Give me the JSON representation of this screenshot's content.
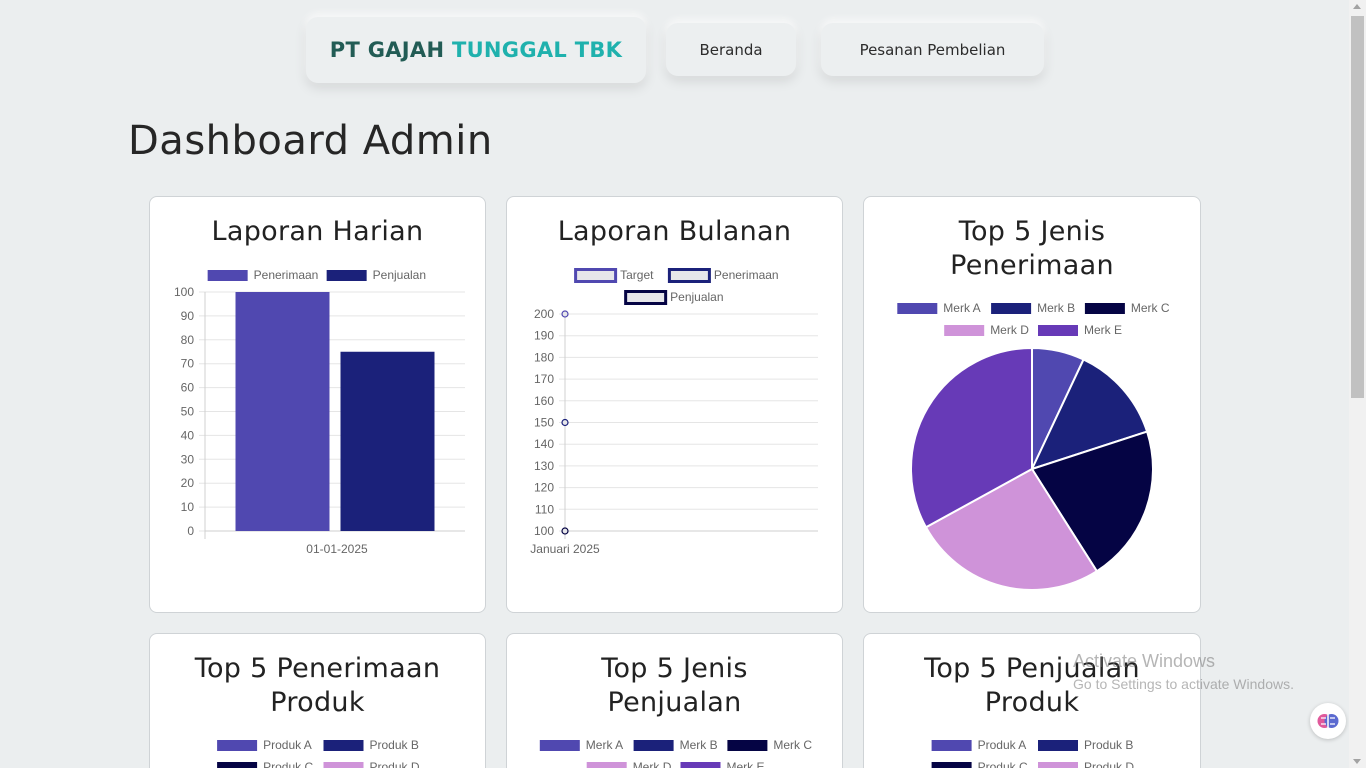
{
  "header": {
    "brand_part1": "PT GAJAH",
    "brand_part2": "TUNGGAL TBK",
    "nav_home": "Beranda",
    "nav_orders": "Pesanan Pembelian"
  },
  "page_title": "Dashboard Admin",
  "cards": [
    {
      "title": "Laporan Harian"
    },
    {
      "title": "Laporan Bulanan"
    },
    {
      "title_line1": "Top 5 Jenis",
      "title_line2": "Penerimaan"
    },
    {
      "title_line1": "Top 5 Penerimaan",
      "title_line2": "Produk"
    },
    {
      "title_line1": "Top 5 Jenis",
      "title_line2": "Penjualan"
    },
    {
      "title_line1": "Top 5 Penjualan",
      "title_line2": "Produk"
    }
  ],
  "watermark": {
    "line1": "Activate Windows",
    "line2": "Go to Settings to activate Windows."
  },
  "icons": {
    "floating_button": "brain-icon"
  },
  "colors": {
    "brand_dark": "#225c55",
    "brand_teal": "#1fb1ad",
    "series_a": "#5048b0",
    "series_b": "#1b217a",
    "series_c": "#050444",
    "series_d": "#cf93d9",
    "series_e": "#673ab7"
  },
  "chart_data": [
    {
      "type": "bar",
      "categories": [
        "01-01-2025"
      ],
      "series": [
        {
          "name": "Penerimaan",
          "values": [
            100
          ],
          "color": "#5048b0"
        },
        {
          "name": "Penjualan",
          "values": [
            75
          ],
          "color": "#1b217a"
        }
      ],
      "ylim": [
        0,
        100
      ],
      "yticks": [
        0,
        10,
        20,
        30,
        40,
        50,
        60,
        70,
        80,
        90,
        100
      ],
      "legend": "top",
      "grid": true
    },
    {
      "type": "line",
      "categories": [
        "Januari 2025"
      ],
      "series": [
        {
          "name": "Target",
          "values": [
            200
          ],
          "color": "#5048b0"
        },
        {
          "name": "Penerimaan",
          "values": [
            150
          ],
          "color": "#1b217a"
        },
        {
          "name": "Penjualan",
          "values": [
            100
          ],
          "color": "#050444"
        }
      ],
      "ylim": [
        100,
        200
      ],
      "yticks": [
        100,
        110,
        120,
        130,
        140,
        150,
        160,
        170,
        180,
        190,
        200
      ],
      "legend": "top",
      "grid": true
    },
    {
      "type": "pie",
      "labels": [
        "Merk A",
        "Merk B",
        "Merk C",
        "Merk D",
        "Merk E"
      ],
      "values": [
        7,
        13,
        21,
        26,
        33
      ],
      "colors": [
        "#5048b0",
        "#1b217a",
        "#050444",
        "#cf93d9",
        "#673ab7"
      ],
      "legend": "top"
    },
    {
      "type": "pie",
      "labels": [
        "Produk A",
        "Produk B",
        "Produk C",
        "Produk D"
      ],
      "colors": [
        "#5048b0",
        "#1b217a",
        "#050444",
        "#cf93d9"
      ],
      "legend": "top"
    },
    {
      "type": "pie",
      "labels": [
        "Merk A",
        "Merk B",
        "Merk C",
        "Merk D",
        "Merk E"
      ],
      "colors": [
        "#5048b0",
        "#1b217a",
        "#050444",
        "#cf93d9",
        "#673ab7"
      ],
      "legend": "top"
    },
    {
      "type": "pie",
      "labels": [
        "Produk A",
        "Produk B",
        "Produk C",
        "Produk D"
      ],
      "colors": [
        "#5048b0",
        "#1b217a",
        "#050444",
        "#cf93d9"
      ],
      "legend": "top"
    }
  ]
}
